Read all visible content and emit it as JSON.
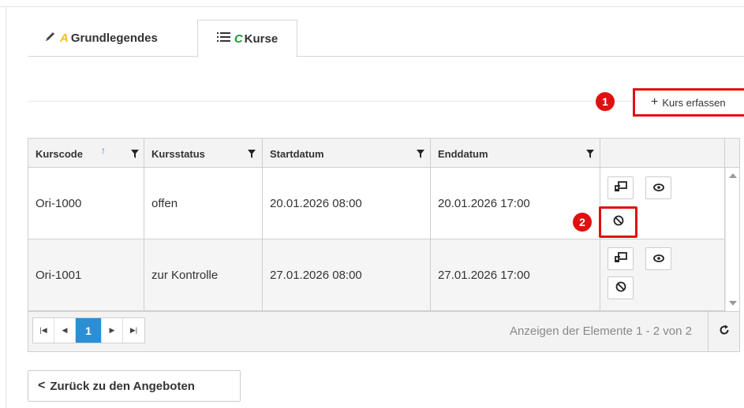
{
  "tabs": [
    {
      "label": "Grundlegendes",
      "letter": "A",
      "icon": "pencil-icon"
    },
    {
      "label": "Kurse",
      "letter": "C",
      "icon": "list-icon"
    }
  ],
  "toolbar": {
    "add_label": "Kurs erfassen",
    "add_marker": "1"
  },
  "table": {
    "columns": [
      "Kurscode",
      "Kursstatus",
      "Startdatum",
      "Enddatum"
    ],
    "rows": [
      {
        "code": "Ori-1000",
        "status": "offen",
        "start": "20.01.2026 08:00",
        "end": "20.01.2026 17:00"
      },
      {
        "code": "Ori-1001",
        "status": "zur Kontrolle",
        "start": "27.01.2026 08:00",
        "end": "27.01.2026 17:00"
      }
    ],
    "action_marker": "2"
  },
  "pager": {
    "current_page": "1",
    "info": "Anzeigen der Elemente 1 - 2 von 2"
  },
  "back": {
    "label": "Zurück zu den Angeboten"
  },
  "colors": {
    "accent_blue": "#2c8fd6",
    "highlight_red": "#e01010",
    "letter_a": "#f4c00e",
    "letter_c": "#1f9c3c"
  }
}
